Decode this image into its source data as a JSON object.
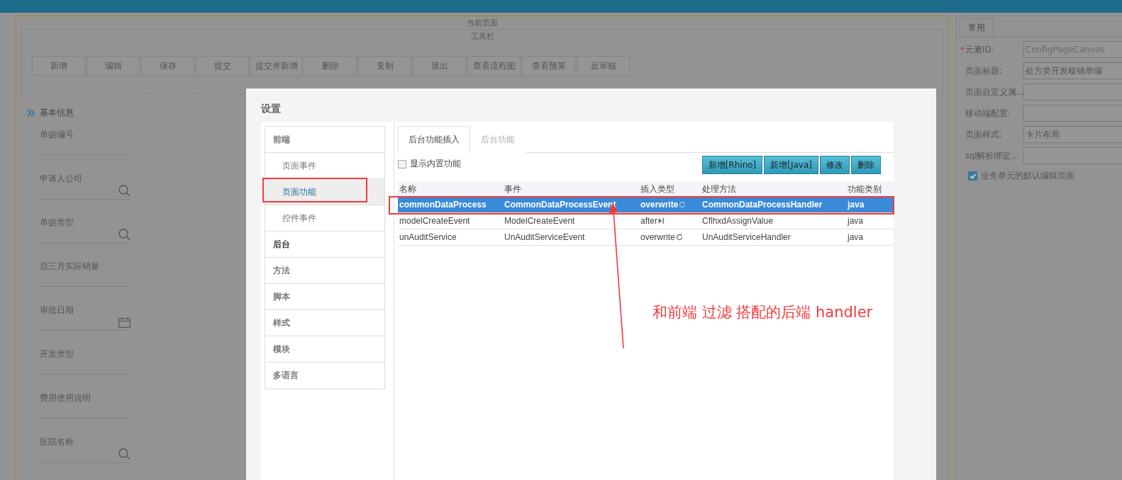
{
  "canvas": {
    "title": "当前页面",
    "toolbar": {
      "title": "工具栏",
      "buttons": [
        "新增",
        "编辑",
        "保存",
        "提交",
        "提交并新增",
        "删除",
        "复制",
        "退出",
        "查看流程图",
        "查看预算",
        "反审核"
      ]
    },
    "section": {
      "title": "基本信息",
      "fields": [
        {
          "label": "单据编号",
          "kind": "text"
        },
        {
          "label": "申请人公司",
          "kind": "lookup"
        },
        {
          "label": "单据类型",
          "kind": "lookup"
        },
        {
          "label": "后三月实际销量",
          "kind": "text"
        },
        {
          "label": "审批日期",
          "kind": "date"
        },
        {
          "label": "开发类型",
          "kind": "text"
        },
        {
          "label": "费用使用说明",
          "kind": "text"
        },
        {
          "label": "医院名称",
          "kind": "lookup"
        }
      ]
    }
  },
  "properties": {
    "tabs": [
      "常用"
    ],
    "fields": [
      {
        "required_mark": "*",
        "label": "元素ID:",
        "value": "ConfigPageCanvas"
      },
      {
        "label": "页面标题:",
        "value": "处方类开发核销单编"
      },
      {
        "label": "页面自定义属..."
      },
      {
        "label": "移动端配置:"
      },
      {
        "label": "页面样式:",
        "value": "卡片布局"
      },
      {
        "label": "sql解析绑定..."
      }
    ],
    "checkbox": {
      "label": "业务单元的默认编辑页面",
      "checked": true
    }
  },
  "dialog": {
    "title": "设置",
    "nav": [
      {
        "label": "前端",
        "kind": "group",
        "selected": false,
        "emphasized": false
      },
      {
        "label": "页面事件",
        "kind": "item",
        "selected": false,
        "emphasized": false
      },
      {
        "label": "页面功能",
        "kind": "item",
        "selected": true,
        "emphasized": false
      },
      {
        "label": "控件事件",
        "kind": "item",
        "selected": false,
        "emphasized": false
      },
      {
        "label": "后台",
        "kind": "group",
        "selected": false,
        "emphasized": true
      },
      {
        "label": "方法",
        "kind": "group",
        "selected": false,
        "emphasized": false
      },
      {
        "label": "脚本",
        "kind": "group",
        "selected": false,
        "emphasized": false
      },
      {
        "label": "样式",
        "kind": "group",
        "selected": false,
        "emphasized": false
      },
      {
        "label": "模块",
        "kind": "group",
        "selected": false,
        "emphasized": false
      },
      {
        "label": "多语言",
        "kind": "group",
        "selected": false,
        "emphasized": false
      }
    ],
    "tabs": [
      {
        "label": "后台功能插入",
        "selected": true
      },
      {
        "label": "后台功能",
        "selected": false
      }
    ],
    "show_builtin": {
      "label": "显示内置功能",
      "checked": false
    },
    "buttons": [
      "新增[Rhino]",
      "新增[Java]",
      "修改",
      "删除"
    ],
    "table": {
      "columns": [
        "名称",
        "事件",
        "插入类型",
        "处理方法",
        "功能类别"
      ],
      "rows": [
        {
          "cells": [
            "commonDataProcess",
            "CommonDataProcessEvent",
            "overwrite",
            "CommonDataProcessHandler",
            "java"
          ],
          "kind": "overwrite",
          "selected": true
        },
        {
          "cells": [
            "modelCreateEvent",
            "ModelCreateEvent",
            "after",
            "CflhxdAssignValue",
            "java"
          ],
          "kind": "after",
          "selected": false
        },
        {
          "cells": [
            "unAuditService",
            "UnAuditServiceEvent",
            "overwrite",
            "UnAuditServiceHandler",
            "java"
          ],
          "kind": "overwrite",
          "selected": false
        }
      ]
    }
  },
  "annotation": {
    "note": "和前端 过滤 搭配的后端 handler"
  }
}
